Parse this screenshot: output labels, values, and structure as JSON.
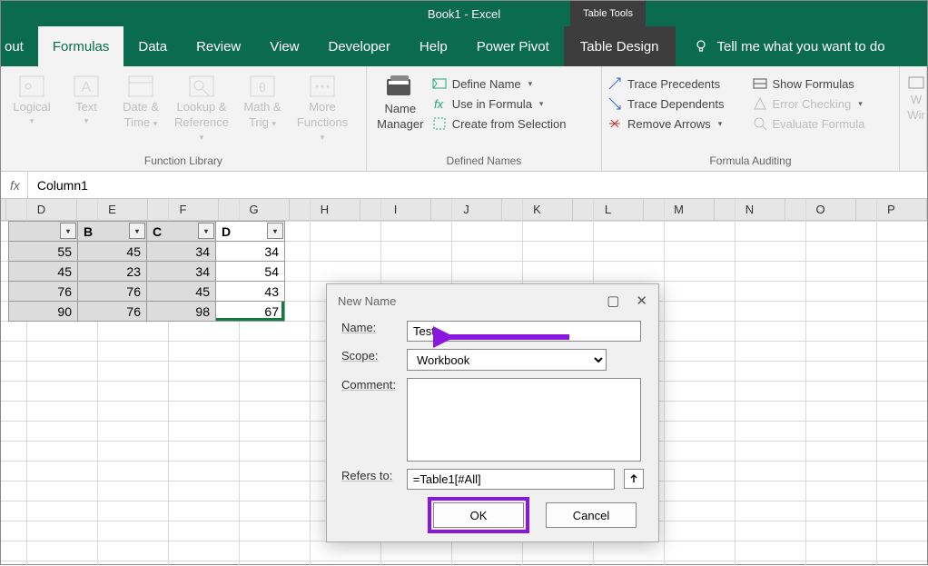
{
  "titlebar": {
    "title": "Book1  -  Excel",
    "tools": "Table Tools"
  },
  "tabs": {
    "cut": "out",
    "formulas": "Formulas",
    "data": "Data",
    "review": "Review",
    "view": "View",
    "developer": "Developer",
    "help": "Help",
    "powerpivot": "Power Pivot",
    "design": "Table Design",
    "tellme": "Tell me what you want to do"
  },
  "ribbon": {
    "function_library": {
      "label": "Function Library",
      "logical": "Logical",
      "text": "Text",
      "datetime_l1": "Date &",
      "datetime_l2": "Time",
      "lookup_l1": "Lookup &",
      "lookup_l2": "Reference",
      "math_l1": "Math &",
      "math_l2": "Trig",
      "more_l1": "More",
      "more_l2": "Functions"
    },
    "defined_names": {
      "label": "Defined Names",
      "name_mgr_l1": "Name",
      "name_mgr_l2": "Manager",
      "define_name": "Define Name",
      "use_in_formula": "Use in Formula",
      "create_selection": "Create from Selection"
    },
    "auditing": {
      "label": "Formula Auditing",
      "trace_precedents": "Trace Precedents",
      "trace_dependents": "Trace Dependents",
      "remove_arrows": "Remove Arrows",
      "show_formulas": "Show Formulas",
      "error_checking": "Error Checking",
      "evaluate_formula": "Evaluate Formula"
    },
    "watch": {
      "l1": "W",
      "l2": "Wir"
    }
  },
  "formulabar": {
    "fx": "fx",
    "value": "Column1"
  },
  "columns": [
    "D",
    "E",
    "F",
    "G",
    "H",
    "I",
    "J",
    "K",
    "L",
    "M",
    "N",
    "O",
    "P"
  ],
  "table": {
    "headers": [
      "B",
      "C",
      "D"
    ],
    "row_leads": [
      "55",
      "45",
      "76",
      "90"
    ],
    "rows": [
      [
        "45",
        "34",
        "34"
      ],
      [
        "23",
        "34",
        "54"
      ],
      [
        "76",
        "45",
        "43"
      ],
      [
        "76",
        "98",
        "67"
      ]
    ]
  },
  "dialog": {
    "title": "New Name",
    "name_label": "Name:",
    "name_value": "Test",
    "scope_label": "Scope:",
    "scope_value": "Workbook",
    "comment_label": "Comment:",
    "refersto_label": "Refers to:",
    "refersto_value": "=Table1[#All]",
    "ok": "OK",
    "cancel": "Cancel"
  }
}
